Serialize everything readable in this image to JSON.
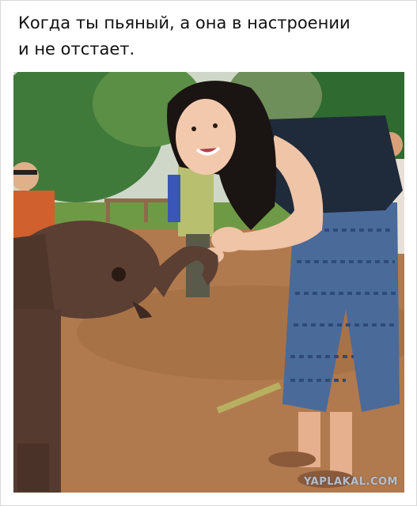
{
  "caption": "Когда ты пьяный, а она в настроении\nи не отстает.",
  "watermark": "YAPLAKAL.COM",
  "colors": {
    "ground": "#b07a4e",
    "foliage": "#3f7a3a",
    "elephant": "#5b3f33",
    "tank_top": "#1f2a3a",
    "pants": "#4a6a9a"
  }
}
